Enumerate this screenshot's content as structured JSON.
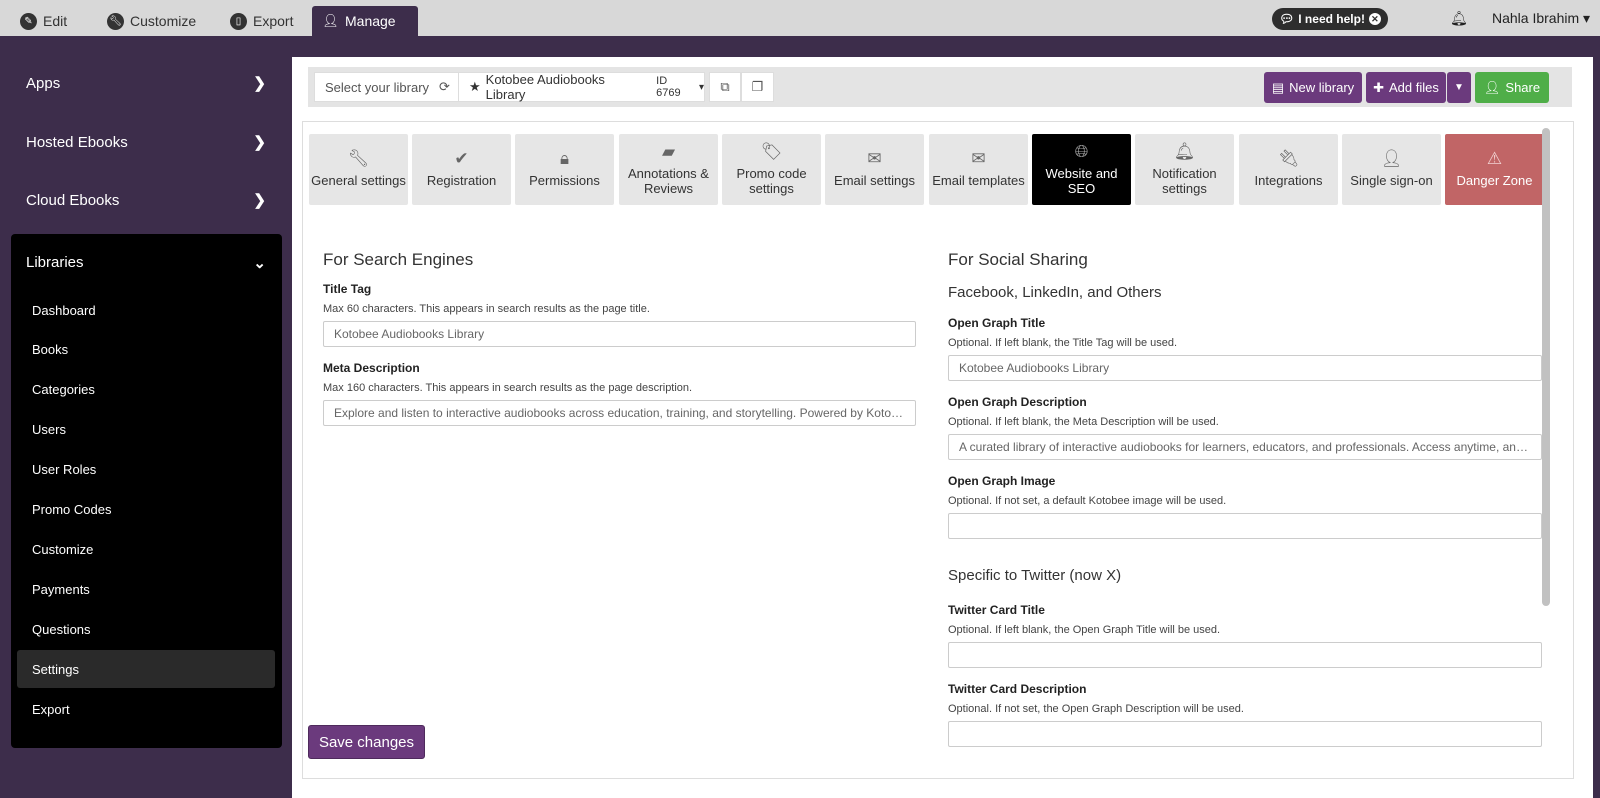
{
  "topnav": {
    "tabs": [
      {
        "label": "Edit",
        "icon": "pencil-icon"
      },
      {
        "label": "Customize",
        "icon": "wrench-icon"
      },
      {
        "label": "Export",
        "icon": "phone-icon"
      },
      {
        "label": "Manage",
        "icon": "user-icon"
      }
    ],
    "help_label": "I need help!",
    "user_name": "Nahla Ibrahim"
  },
  "sidebar": {
    "top_items": [
      "Apps",
      "Hosted Ebooks",
      "Cloud Ebooks"
    ],
    "libraries_label": "Libraries",
    "library_items": [
      "Dashboard",
      "Books",
      "Categories",
      "Users",
      "User Roles",
      "Promo Codes",
      "Customize",
      "Payments",
      "Questions",
      "Settings",
      "Export"
    ],
    "active_item": "Settings"
  },
  "libbar": {
    "select_label": "Select your library",
    "library_name": "Kotobee Audiobooks Library",
    "library_id": "ID 6769",
    "new_library": "New library",
    "add_files": "Add files",
    "share": "Share"
  },
  "settings_tabs": [
    {
      "label": "General settings",
      "icon": "wrench-icon"
    },
    {
      "label": "Registration",
      "icon": "check-icon"
    },
    {
      "label": "Permissions",
      "icon": "lock-icon"
    },
    {
      "label": "Annotations & Reviews",
      "icon": "note-icon"
    },
    {
      "label": "Promo code settings",
      "icon": "tag-icon"
    },
    {
      "label": "Email settings",
      "icon": "envelope-icon"
    },
    {
      "label": "Email templates",
      "icon": "envelope-icon"
    },
    {
      "label": "Website and SEO",
      "icon": "globe-icon"
    },
    {
      "label": "Notification settings",
      "icon": "bell-icon"
    },
    {
      "label": "Integrations",
      "icon": "plug-icon"
    },
    {
      "label": "Single sign-on",
      "icon": "user-icon"
    },
    {
      "label": "Danger Zone",
      "icon": "warning-icon"
    }
  ],
  "active_tab": "Website and SEO",
  "search": {
    "title": "For Search Engines",
    "title_tag_label": "Title Tag",
    "title_tag_help": "Max 60 characters. This appears in search results as the page title.",
    "title_tag_value": "Kotobee Audiobooks Library",
    "meta_label": "Meta Description",
    "meta_help": "Max 160 characters. This appears in search results as the page description.",
    "meta_value": "Explore and listen to interactive audiobooks across education, training, and storytelling. Powered by Kotobee."
  },
  "social": {
    "title": "For Social Sharing",
    "fb_subtitle": "Facebook, LinkedIn, and Others",
    "og_title_label": "Open Graph Title",
    "og_title_help": "Optional. If left blank, the Title Tag will be used.",
    "og_title_value": "Kotobee Audiobooks Library",
    "og_desc_label": "Open Graph Description",
    "og_desc_help": "Optional. If left blank, the Meta Description will be used.",
    "og_desc_value": "A curated library of interactive audiobooks for learners, educators, and professionals. Access anytime, anywhere.",
    "og_image_label": "Open Graph Image",
    "og_image_help": "Optional. If not set, a default Kotobee image will be used.",
    "og_image_value": "",
    "twitter_subtitle": "Specific to Twitter (now X)",
    "tw_title_label": "Twitter Card Title",
    "tw_title_help": "Optional. If left blank, the Open Graph Title will be used.",
    "tw_title_value": "",
    "tw_desc_label": "Twitter Card Description",
    "tw_desc_help": "Optional. If not set, the Open Graph Description will be used."
  },
  "save_label": "Save changes"
}
